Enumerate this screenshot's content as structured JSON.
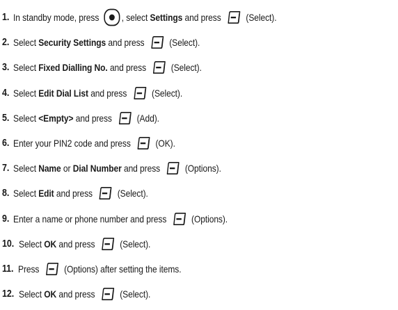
{
  "steps": [
    {
      "num": "1.",
      "parts": [
        {
          "t": "In standby mode, press ",
          "b": false
        },
        {
          "icon": "center-key-icon"
        },
        {
          "t": ", select ",
          "b": false
        },
        {
          "t": "Settings",
          "b": true
        },
        {
          "t": " and press ",
          "b": false
        },
        {
          "icon": "soft-key-icon"
        },
        {
          "t": " (Select).",
          "b": false
        }
      ]
    },
    {
      "num": "2.",
      "parts": [
        {
          "t": "Select ",
          "b": false
        },
        {
          "t": "Security Settings",
          "b": true
        },
        {
          "t": " and press ",
          "b": false
        },
        {
          "icon": "soft-key-icon"
        },
        {
          "t": " (Select).",
          "b": false
        }
      ]
    },
    {
      "num": "3.",
      "parts": [
        {
          "t": "Select ",
          "b": false
        },
        {
          "t": "Fixed Dialling No.",
          "b": true
        },
        {
          "t": " and press ",
          "b": false
        },
        {
          "icon": "soft-key-icon"
        },
        {
          "t": " (Select).",
          "b": false
        }
      ]
    },
    {
      "num": "4.",
      "parts": [
        {
          "t": "Select ",
          "b": false
        },
        {
          "t": "Edit Dial List",
          "b": true
        },
        {
          "t": " and press ",
          "b": false
        },
        {
          "icon": "soft-key-icon"
        },
        {
          "t": " (Select).",
          "b": false
        }
      ]
    },
    {
      "num": "5.",
      "parts": [
        {
          "t": "Select ",
          "b": false
        },
        {
          "t": "<Empty>",
          "b": true
        },
        {
          "t": " and press ",
          "b": false
        },
        {
          "icon": "soft-key-icon"
        },
        {
          "t": " (Add).",
          "b": false
        }
      ]
    },
    {
      "num": "6.",
      "parts": [
        {
          "t": "Enter your PIN2 code and press ",
          "b": false
        },
        {
          "icon": "soft-key-icon"
        },
        {
          "t": " (OK).",
          "b": false
        }
      ]
    },
    {
      "num": "7.",
      "parts": [
        {
          "t": "Select ",
          "b": false
        },
        {
          "t": "Name",
          "b": true
        },
        {
          "t": " or ",
          "b": false
        },
        {
          "t": "Dial Number",
          "b": true
        },
        {
          "t": " and press ",
          "b": false
        },
        {
          "icon": "soft-key-icon"
        },
        {
          "t": " (Options).",
          "b": false
        }
      ]
    },
    {
      "num": "8.",
      "parts": [
        {
          "t": "Select ",
          "b": false
        },
        {
          "t": "Edit",
          "b": true
        },
        {
          "t": " and press ",
          "b": false
        },
        {
          "icon": "soft-key-icon"
        },
        {
          "t": " (Select).",
          "b": false
        }
      ]
    },
    {
      "num": "9.",
      "parts": [
        {
          "t": "Enter a name or phone number and press ",
          "b": false
        },
        {
          "icon": "soft-key-icon"
        },
        {
          "t": " (Options).",
          "b": false
        }
      ]
    },
    {
      "num": "10.",
      "parts": [
        {
          "t": "Select ",
          "b": false
        },
        {
          "t": "OK",
          "b": true
        },
        {
          "t": " and press ",
          "b": false
        },
        {
          "icon": "soft-key-icon"
        },
        {
          "t": " (Select).",
          "b": false
        }
      ]
    },
    {
      "num": "11.",
      "parts": [
        {
          "t": "Press ",
          "b": false
        },
        {
          "icon": "soft-key-icon"
        },
        {
          "t": " (Options) after setting the items.",
          "b": false
        }
      ]
    },
    {
      "num": "12.",
      "parts": [
        {
          "t": "Select ",
          "b": false
        },
        {
          "t": "OK",
          "b": true
        },
        {
          "t": " and press ",
          "b": false
        },
        {
          "icon": "soft-key-icon"
        },
        {
          "t": " (Select).",
          "b": false
        }
      ]
    }
  ]
}
